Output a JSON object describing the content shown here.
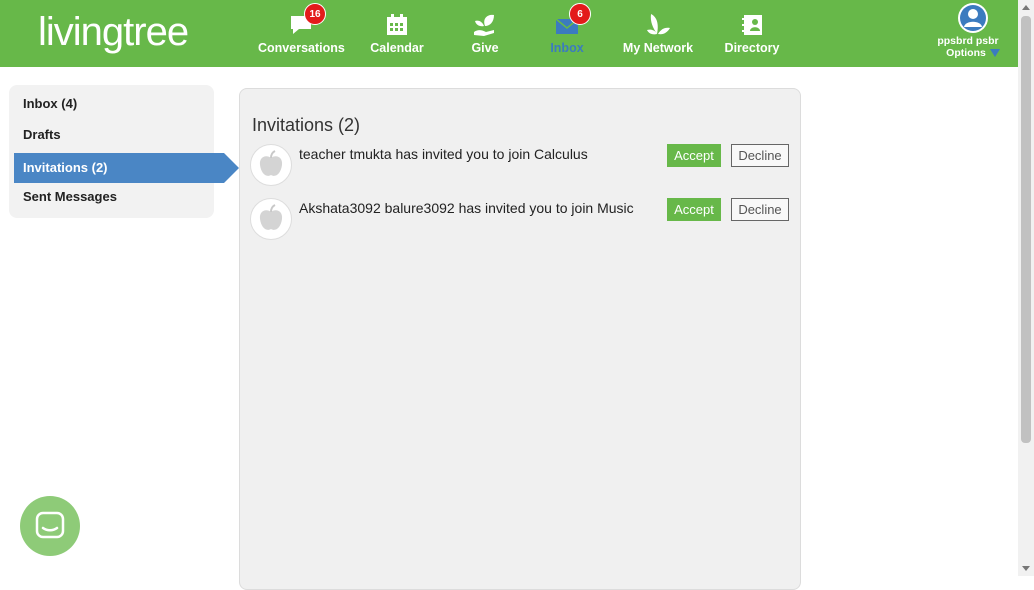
{
  "brand": {
    "logo_text": "livingtree"
  },
  "nav": {
    "items": [
      {
        "label": "Conversations",
        "badge": "16"
      },
      {
        "label": "Calendar"
      },
      {
        "label": "Give"
      },
      {
        "label": "Inbox",
        "badge": "6"
      },
      {
        "label": "My Network"
      },
      {
        "label": "Directory"
      }
    ],
    "active_color": "#3b7bbf"
  },
  "user": {
    "name": "ppsbrd psbr",
    "options_label": "Options"
  },
  "sidebar": {
    "items": [
      {
        "label": "Inbox (4)"
      },
      {
        "label": "Drafts"
      },
      {
        "label": "Invitations (2)"
      },
      {
        "label": "Sent Messages"
      }
    ]
  },
  "main": {
    "title": "Invitations (2)",
    "invitations": [
      {
        "text": "teacher tmukta has invited you to join Calculus",
        "accept_label": "Accept",
        "decline_label": "Decline"
      },
      {
        "text": "Akshata3092 balure3092 has invited you to join Music",
        "accept_label": "Accept",
        "decline_label": "Decline"
      }
    ]
  },
  "colors": {
    "brand_green": "#67b849",
    "accent_blue": "#4a86c5",
    "badge_red": "#e31b1b"
  },
  "icons": [
    "chat-bubble-icon",
    "calendar-icon",
    "give-hand-leaf-icon",
    "envelope-icon",
    "network-leaves-icon",
    "directory-contact-icon",
    "user-avatar-icon",
    "apple-icon",
    "chat-launcher-icon"
  ]
}
